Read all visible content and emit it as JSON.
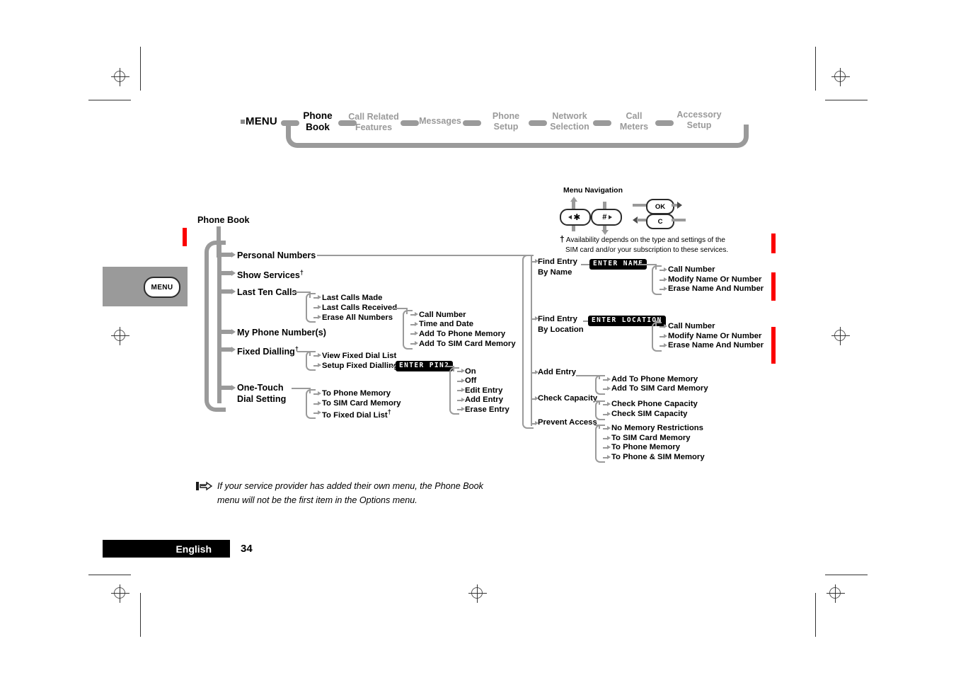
{
  "page": {
    "language_label": "English",
    "page_number": "34"
  },
  "topnav": {
    "menu_word": "MENU",
    "items": [
      {
        "line1": "Phone",
        "line2": "Book",
        "current": true
      },
      {
        "line1": "Call Related",
        "line2": "Features",
        "current": false
      },
      {
        "line1": "Messages",
        "line2": "",
        "current": false
      },
      {
        "line1": "Phone",
        "line2": "Setup",
        "current": false
      },
      {
        "line1": "Network",
        "line2": "Selection",
        "current": false
      },
      {
        "line1": "Call",
        "line2": "Meters",
        "current": false
      },
      {
        "line1": "Accessory",
        "line2": "Setup",
        "current": false
      }
    ]
  },
  "menu_tab": {
    "button_label": "MENU"
  },
  "navigation": {
    "title": "Menu Navigation",
    "key_star": "✱",
    "key_hash": "#",
    "key_ok": "OK",
    "key_clear": "C",
    "footnote_marker": "†",
    "footnote_line1": "Availability depends on the type and settings of the",
    "footnote_line2": "SIM card and/or your subscription to these services."
  },
  "tree": {
    "root": "Phone Book",
    "level1": [
      {
        "label": "Personal Numbers",
        "dagger": false
      },
      {
        "label": "Show Services",
        "dagger": true
      },
      {
        "label": "Last Ten Calls",
        "dagger": false
      },
      {
        "label": "My Phone Number(s)",
        "dagger": false
      },
      {
        "label": "Fixed Dialling",
        "dagger": true
      },
      {
        "label_line1": "One-Touch",
        "label_line2": "Dial Setting",
        "dagger": false
      }
    ],
    "last_ten_calls": [
      {
        "label": "Last Calls Made",
        "dagger": false
      },
      {
        "label": "Last Calls Received",
        "dagger": false
      },
      {
        "label": "Erase All Numbers",
        "dagger": false
      }
    ],
    "last_calls_received_sub": [
      "Call Number",
      "Time and Date",
      "Add To Phone Memory",
      "Add To SIM Card Memory"
    ],
    "fixed_dialling": [
      {
        "label": "View Fixed Dial List",
        "dagger": false
      },
      {
        "label": "Setup Fixed Dialling",
        "dagger": false
      }
    ],
    "enter_pin2_label": "ENTER PIN2",
    "setup_fixed_dialling_sub": [
      "On",
      "Off",
      "Edit Entry",
      "Add Entry",
      "Erase Entry"
    ],
    "one_touch_sub": [
      {
        "label": "To Phone Memory",
        "dagger": false
      },
      {
        "label": "To SIM Card Memory",
        "dagger": false
      },
      {
        "label": "To Fixed Dial List",
        "dagger": true
      }
    ],
    "right_branches": [
      {
        "line1": "Find Entry",
        "line2": "By Name"
      },
      {
        "line1": "Find Entry",
        "line2": "By Location"
      },
      {
        "line1": "Add Entry",
        "line2": ""
      },
      {
        "line1": "Check Capacity",
        "line2": ""
      },
      {
        "line1": "Prevent Access",
        "line2": ""
      }
    ],
    "enter_name_label": "ENTER NAME",
    "enter_location_label": "ENTER LOCATION",
    "find_by_name_sub": [
      "Call Number",
      "Modify Name Or Number",
      "Erase Name And Number"
    ],
    "find_by_location_sub": [
      "Call Number",
      "Modify Name Or Number",
      "Erase Name And Number"
    ],
    "add_entry_sub": [
      "Add To Phone Memory",
      "Add To SIM Card Memory"
    ],
    "check_capacity_sub": [
      "Check Phone Capacity",
      "Check SIM Capacity"
    ],
    "prevent_access_sub": [
      "No Memory Restrictions",
      "To SIM Card Memory",
      "To Phone Memory",
      "To Phone & SIM Memory"
    ]
  },
  "note": {
    "icon": "pointing-hand",
    "text": "If your service provider has added their own menu, the Phone Book menu will not be the first item in the Options menu."
  },
  "colors": {
    "change_bar": "#fb0000",
    "line_gray": "#9a9a9a",
    "tab_gray": "#9a9a9a"
  }
}
